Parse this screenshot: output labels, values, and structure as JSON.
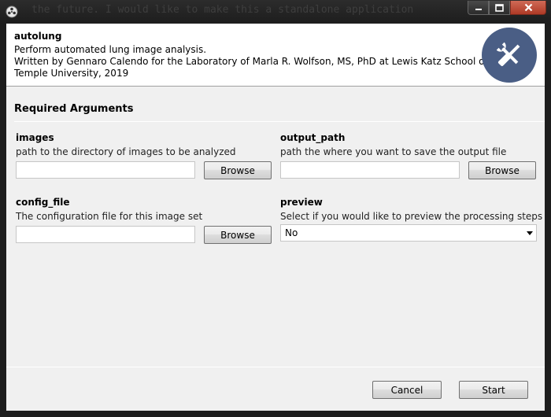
{
  "window": {
    "background_text": "the future.  I would like to make this a standalone application",
    "controls": [
      "minimize",
      "maximize",
      "close"
    ]
  },
  "header": {
    "title": "autolung",
    "description": "Perform automated lung image analysis.",
    "author_line": "Written by Gennaro Calendo for the Laboratory of Marla R. Wolfson, MS, PhD at Lewis Katz School of Medicine",
    "institution_line": "Temple University, 2019",
    "logo_icon": "tools-icon"
  },
  "section": {
    "title": "Required Arguments"
  },
  "args": {
    "images": {
      "name": "images",
      "help": "path to the directory of images to be analyzed",
      "value": "",
      "browse_label": "Browse"
    },
    "output_path": {
      "name": "output_path",
      "help": "path the where you want to save the output file",
      "value": "",
      "browse_label": "Browse"
    },
    "config_file": {
      "name": "config_file",
      "help": "The configuration file for this image set",
      "value": "",
      "browse_label": "Browse"
    },
    "preview": {
      "name": "preview",
      "help": "Select if you would like to preview the processing steps",
      "selected": "No"
    }
  },
  "footer": {
    "cancel_label": "Cancel",
    "start_label": "Start"
  },
  "colors": {
    "logo_bg": "#4a5e85",
    "client_bg": "#f0f0f0",
    "close_button": "#c24a35"
  }
}
